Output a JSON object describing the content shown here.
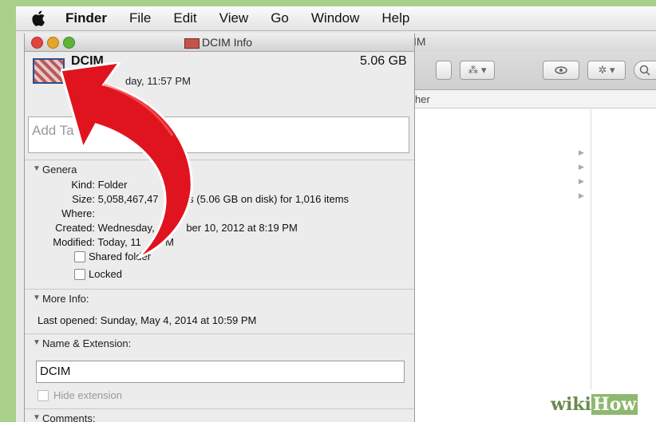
{
  "menubar": {
    "items": [
      "Finder",
      "File",
      "Edit",
      "View",
      "Go",
      "Window",
      "Help"
    ]
  },
  "finder_window": {
    "title_fragment": "IM",
    "header_fragment": "her"
  },
  "info_window": {
    "title": "DCIM Info",
    "name": "DCIM",
    "size": "5.06 GB",
    "modified_fragment": "day, 11:57 PM",
    "tags_placeholder": "Add Ta",
    "general": {
      "heading": "Genera",
      "kind_label": "Kind:",
      "kind_value": "Folder",
      "size_label": "Size:",
      "size_value": "5,058,467,47",
      "size_value_tail": "s (5.06 GB on disk) for 1,016 items",
      "where_label": "Where:",
      "created_label": "Created:",
      "created_value": "Wednesday,",
      "created_tail": "ber 10, 2012 at 8:19 PM",
      "modified_label": "Modified:",
      "modified_value": "Today, 11",
      "modified_tail": "PM",
      "shared_label": "Shared folder",
      "locked_label": "Locked"
    },
    "more_info": {
      "heading": "More Info:",
      "last_opened": "Last opened: Sunday, May 4, 2014 at 10:59 PM"
    },
    "name_ext": {
      "heading": "Name & Extension:",
      "value": "DCIM",
      "hide_label": "Hide extension"
    },
    "comments": {
      "heading": "Comments:"
    }
  },
  "watermark": {
    "part1": "wiki",
    "part2": "How"
  },
  "colors": {
    "arrow": "#e0141e",
    "background": "#a8d08a",
    "close": "#e0443e",
    "min": "#e5a52a",
    "max": "#60b33a"
  },
  "icons": [
    "apple-logo-icon",
    "folder-image-icon",
    "eye-icon",
    "gear-icon",
    "search-icon",
    "disclosure-triangle-icon"
  ]
}
